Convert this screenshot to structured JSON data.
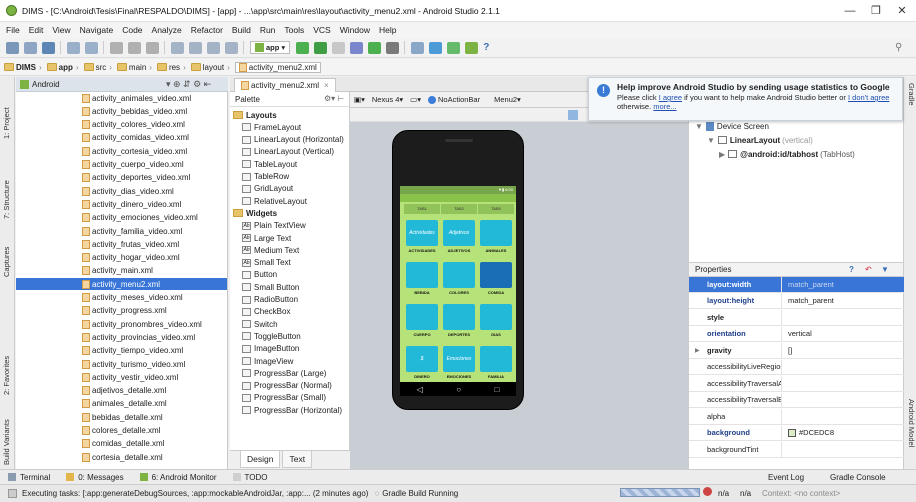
{
  "window": {
    "title": "DIMS - [C:\\Android\\Tesis\\Final\\RESPALDO\\DIMS] - [app] - ...\\app\\src\\main\\res\\layout\\activity_menu2.xml - Android Studio 2.1.1",
    "min": "—",
    "max": "❐",
    "close": "✕"
  },
  "menu": [
    "File",
    "Edit",
    "View",
    "Navigate",
    "Code",
    "Analyze",
    "Refactor",
    "Build",
    "Run",
    "Tools",
    "VCS",
    "Window",
    "Help"
  ],
  "toolbar": {
    "module": "app",
    "help": "?"
  },
  "breadcrumbs": [
    "DIMS",
    "app",
    "src",
    "main",
    "res",
    "layout",
    "activity_menu2.xml"
  ],
  "left_strip": [
    "1: Project",
    "7: Structure",
    "Captures",
    "2: Favorites",
    "Build Variants"
  ],
  "right_strip": [
    "Gradle",
    "Android Model"
  ],
  "project": {
    "view": "Android",
    "files": [
      "activity_animales_video.xml",
      "activity_bebidas_video.xml",
      "activity_colores_video.xml",
      "activity_comidas_video.xml",
      "activity_cortesia_video.xml",
      "activity_cuerpo_video.xml",
      "activity_deportes_video.xml",
      "activity_dias_video.xml",
      "activity_dinero_video.xml",
      "activity_emociones_video.xml",
      "activity_familia_video.xml",
      "activity_frutas_video.xml",
      "activity_hogar_video.xml",
      "activity_main.xml",
      "activity_menu2.xml",
      "activity_meses_video.xml",
      "activity_progress.xml",
      "activity_pronombres_video.xml",
      "activity_provincias_video.xml",
      "activity_tiempo_video.xml",
      "activity_turismo_video.xml",
      "activity_vestir_video.xml",
      "adjetivos_detalle.xml",
      "animales_detalle.xml",
      "bebidas_detalle.xml",
      "colores_detalle.xml",
      "comidas_detalle.xml",
      "cortesia_detalle.xml"
    ],
    "selected": "activity_menu2.xml"
  },
  "editor_tab": "activity_menu2.xml",
  "palette": {
    "title": "Palette",
    "categories": [
      {
        "name": "Layouts",
        "items": [
          "FrameLayout",
          "LinearLayout (Horizontal)",
          "LinearLayout (Vertical)",
          "TableLayout",
          "TableRow",
          "GridLayout",
          "RelativeLayout"
        ]
      },
      {
        "name": "Widgets",
        "items": [
          "Plain TextView",
          "Large Text",
          "Medium Text",
          "Small Text",
          "Button",
          "Small Button",
          "RadioButton",
          "CheckBox",
          "Switch",
          "ToggleButton",
          "ImageButton",
          "ImageView",
          "ProgressBar (Large)",
          "ProgressBar (Normal)",
          "ProgressBar (Small)",
          "ProgressBar (Horizontal)"
        ]
      }
    ],
    "ab": "Ab"
  },
  "design_tabs": [
    "Design",
    "Text"
  ],
  "device_bar": [
    "Nexus 4▾",
    "NoActionBar",
    "Menu2▾"
  ],
  "phone": {
    "status": "▼▮ 6:00",
    "tabs": [
      "TAB1",
      "TAB2",
      "TAB3"
    ],
    "tiles": [
      {
        "label": "ACTIVIDADES",
        "text": "Actividades",
        "color": "#22b8d8"
      },
      {
        "label": "ADJETIVOS",
        "text": "Adjetivos",
        "color": "#22b8d8"
      },
      {
        "label": "ANIMALES",
        "text": "",
        "color": "#22b8d8"
      },
      {
        "label": "BEBIDA",
        "text": "",
        "color": "#22b8d8"
      },
      {
        "label": "COLORES",
        "text": "",
        "color": "#22b8d8"
      },
      {
        "label": "COMIDA",
        "text": "",
        "color": "#1a6fb4"
      },
      {
        "label": "CUERPO",
        "text": "",
        "color": "#22b8d8"
      },
      {
        "label": "DEPORTES",
        "text": "",
        "color": "#22b8d8"
      },
      {
        "label": "DIAS",
        "text": "",
        "color": "#22b8d8"
      },
      {
        "label": "DINERO",
        "text": "$",
        "color": "#22b8d8"
      },
      {
        "label": "EMOCIONES",
        "text": "Emociones",
        "color": "#22b8d8"
      },
      {
        "label": "FAMILIA",
        "text": "",
        "color": "#22b8d8"
      }
    ],
    "nav": [
      "◁",
      "○",
      "□"
    ]
  },
  "notification": {
    "title": "Help improve Android Studio by sending usage statistics to Google",
    "line1a": "Please click ",
    "agree": "I agree",
    "line1b": " if you want to help make Android Studio better or ",
    "dont": "I don't agree",
    "line1c": " otherwise. ",
    "more": "more..."
  },
  "tree": {
    "root": "Device Screen",
    "linear": "LinearLayout",
    "linear_hint": "(vertical)",
    "tabhost": "@android:id/tabhost",
    "tabhost_hint": "(TabHost)"
  },
  "properties": {
    "title": "Properties",
    "tools": [
      "?",
      "↶",
      "▼"
    ],
    "rows": [
      {
        "k": "layout:width",
        "v": "match_parent",
        "hl": true,
        "bold": true
      },
      {
        "k": "layout:height",
        "v": "match_parent",
        "bold": true,
        "blue": true
      },
      {
        "k": "style",
        "v": "",
        "bold": true
      },
      {
        "k": "orientation",
        "v": "vertical",
        "bold": true,
        "blue": true
      },
      {
        "k": "gravity",
        "v": "[]",
        "bold": true
      },
      {
        "k": "accessibilityLiveRegion",
        "v": ""
      },
      {
        "k": "accessibilityTraversalAfte",
        "v": ""
      },
      {
        "k": "accessibilityTraversalBefc",
        "v": ""
      },
      {
        "k": "alpha",
        "v": ""
      },
      {
        "k": "background",
        "v": "#DCEDC8",
        "bold": true,
        "blue": true
      },
      {
        "k": "backgroundTint",
        "v": ""
      }
    ]
  },
  "bottom_tools": [
    "Terminal",
    "0: Messages",
    "6: Android Monitor",
    "TODO"
  ],
  "bottom_right": [
    "Event Log",
    "Gradle Console"
  ],
  "status": {
    "text": "Executing tasks: [:app:generateDebugSources, :app:mockableAndroidJar, :app:... (2 minutes ago)",
    "task": "Gradle Build Running",
    "right": [
      "n/a",
      "n/a",
      "Context: <no context>"
    ]
  }
}
